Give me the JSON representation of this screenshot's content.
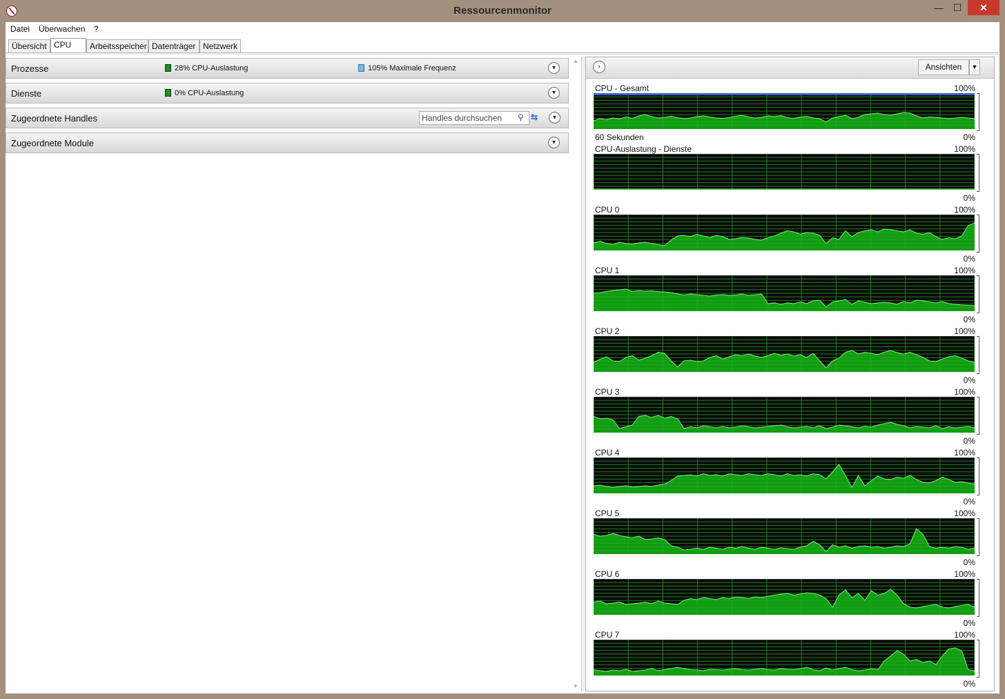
{
  "window": {
    "title": "Ressourcenmonitor"
  },
  "menu": {
    "file": "Datei",
    "monitor": "Überwachen",
    "help": "?"
  },
  "tabs": [
    "Übersicht",
    "CPU",
    "Arbeitsspeicher",
    "Datenträger",
    "Netzwerk"
  ],
  "active_tab": "CPU",
  "sections": {
    "processes": {
      "label": "Prozesse",
      "cpu_usage": "28% CPU-Auslastung",
      "max_freq": "105% Maximale Frequenz"
    },
    "services": {
      "label": "Dienste",
      "cpu_usage": "0% CPU-Auslastung"
    },
    "handles": {
      "label": "Zugeordnete Handles",
      "search_placeholder": "Handles durchsuchen"
    },
    "modules": {
      "label": "Zugeordnete Module"
    }
  },
  "right_pane": {
    "views_button": "Ansichten"
  },
  "colors": {
    "graph_bg": "#0b0b0b",
    "grid": "#1e7a1e",
    "fill": "#15b515",
    "line": "#7cf07c",
    "freq_line": "#3a62c8"
  },
  "graphs": [
    {
      "title": "CPU - Gesamt",
      "max": "100%",
      "min": "0%",
      "caption": "60 Sekunden",
      "values": [
        22,
        28,
        25,
        30,
        27,
        33,
        29,
        36,
        40,
        34,
        30,
        32,
        35,
        31,
        28,
        30,
        34,
        36,
        33,
        30,
        29,
        31,
        35,
        38,
        33,
        30,
        32,
        36,
        34,
        37,
        31,
        29,
        33,
        35,
        30,
        28,
        18,
        30,
        34,
        38,
        28,
        32,
        40,
        42,
        44,
        40,
        38,
        42,
        46,
        44,
        36,
        30,
        33,
        32,
        30,
        28,
        30,
        32,
        30,
        28
      ]
    },
    {
      "title": "CPU-Auslastung - Dienste",
      "max": "100%",
      "min": "0%",
      "caption": "",
      "values": [
        0,
        0,
        0,
        0,
        0,
        0,
        0,
        0,
        0,
        0,
        0,
        0,
        0,
        0,
        0,
        0,
        0,
        0,
        0,
        0,
        0,
        0,
        0,
        0,
        0,
        0,
        0,
        0,
        0,
        0,
        0,
        0,
        0,
        0,
        0,
        0,
        0,
        0,
        0,
        0,
        0,
        0,
        0,
        0,
        0,
        0,
        0,
        0,
        0,
        0,
        0,
        0,
        0,
        0,
        0,
        0,
        0,
        0,
        0,
        0
      ]
    },
    {
      "title": "CPU 0",
      "max": "100%",
      "min": "0%",
      "caption": "",
      "values": [
        20,
        25,
        18,
        15,
        22,
        18,
        16,
        20,
        22,
        18,
        15,
        12,
        28,
        40,
        42,
        38,
        45,
        40,
        35,
        42,
        38,
        30,
        32,
        36,
        34,
        30,
        28,
        35,
        40,
        48,
        55,
        52,
        45,
        50,
        48,
        42,
        18,
        35,
        30,
        55,
        38,
        50,
        55,
        58,
        52,
        60,
        58,
        55,
        52,
        58,
        48,
        45,
        50,
        38,
        30,
        35,
        32,
        40,
        70,
        78
      ]
    },
    {
      "title": "CPU 1",
      "max": "100%",
      "min": "0%",
      "caption": "",
      "values": [
        50,
        52,
        55,
        58,
        60,
        62,
        55,
        58,
        56,
        57,
        55,
        54,
        52,
        48,
        45,
        48,
        46,
        44,
        42,
        45,
        46,
        44,
        45,
        48,
        44,
        46,
        48,
        20,
        22,
        18,
        22,
        20,
        25,
        20,
        28,
        30,
        10,
        25,
        28,
        32,
        18,
        28,
        24,
        20,
        22,
        24,
        22,
        18,
        26,
        22,
        30,
        28,
        25,
        22,
        26,
        20,
        18,
        16,
        15,
        14
      ]
    },
    {
      "title": "CPU 2",
      "max": "100%",
      "min": "0%",
      "caption": "",
      "values": [
        25,
        35,
        42,
        30,
        28,
        40,
        45,
        32,
        38,
        45,
        55,
        52,
        30,
        12,
        30,
        32,
        28,
        30,
        40,
        45,
        35,
        42,
        48,
        45,
        50,
        44,
        40,
        45,
        52,
        46,
        50,
        44,
        48,
        40,
        52,
        30,
        10,
        30,
        38,
        55,
        60,
        50,
        55,
        52,
        48,
        55,
        60,
        54,
        50,
        55,
        48,
        40,
        30,
        28,
        35,
        42,
        45,
        38,
        30,
        25
      ]
    },
    {
      "title": "CPU 3",
      "max": "100%",
      "min": "0%",
      "caption": "",
      "values": [
        45,
        38,
        40,
        35,
        10,
        15,
        20,
        45,
        48,
        42,
        48,
        40,
        45,
        38,
        10,
        15,
        12,
        18,
        15,
        12,
        16,
        12,
        14,
        18,
        15,
        12,
        14,
        16,
        18,
        20,
        15,
        12,
        14,
        16,
        12,
        18,
        10,
        14,
        20,
        18,
        15,
        12,
        16,
        14,
        20,
        24,
        28,
        22,
        18,
        12,
        16,
        14,
        12,
        18,
        10,
        15,
        12,
        14,
        16,
        12
      ]
    },
    {
      "title": "CPU 4",
      "max": "100%",
      "min": "0%",
      "caption": "",
      "values": [
        20,
        22,
        18,
        15,
        18,
        20,
        16,
        18,
        20,
        18,
        22,
        25,
        35,
        48,
        50,
        52,
        48,
        55,
        50,
        52,
        48,
        55,
        52,
        50,
        55,
        52,
        50,
        55,
        52,
        48,
        55,
        50,
        52,
        48,
        55,
        52,
        40,
        60,
        82,
        50,
        15,
        50,
        20,
        35,
        48,
        40,
        38,
        45,
        42,
        50,
        38,
        30,
        28,
        35,
        45,
        38,
        30,
        32,
        28,
        25
      ]
    },
    {
      "title": "CPU 5",
      "max": "100%",
      "min": "0%",
      "caption": "",
      "values": [
        55,
        50,
        52,
        58,
        52,
        48,
        45,
        50,
        40,
        42,
        45,
        40,
        22,
        18,
        10,
        12,
        15,
        12,
        18,
        15,
        12,
        18,
        15,
        20,
        15,
        12,
        18,
        15,
        12,
        16,
        14,
        12,
        18,
        22,
        35,
        25,
        5,
        25,
        18,
        22,
        15,
        20,
        22,
        18,
        20,
        15,
        18,
        22,
        20,
        28,
        72,
        55,
        20,
        15,
        18,
        15,
        20,
        18,
        12,
        15
      ]
    },
    {
      "title": "CPU 6",
      "max": "100%",
      "min": "0%",
      "caption": "",
      "values": [
        35,
        38,
        30,
        32,
        35,
        28,
        30,
        32,
        35,
        30,
        38,
        32,
        30,
        28,
        40,
        45,
        42,
        48,
        45,
        42,
        48,
        45,
        50,
        48,
        45,
        50,
        48,
        52,
        55,
        58,
        60,
        55,
        58,
        62,
        60,
        55,
        45,
        20,
        55,
        70,
        48,
        60,
        40,
        68,
        55,
        60,
        72,
        55,
        30,
        20,
        18,
        22,
        25,
        28,
        20,
        18,
        22,
        25,
        28,
        20
      ]
    },
    {
      "title": "CPU 7",
      "max": "100%",
      "min": "0%",
      "caption": "",
      "values": [
        15,
        12,
        10,
        14,
        12,
        16,
        10,
        12,
        14,
        18,
        12,
        15,
        18,
        22,
        18,
        15,
        14,
        12,
        16,
        15,
        14,
        16,
        18,
        15,
        14,
        16,
        18,
        15,
        14,
        18,
        16,
        15,
        18,
        22,
        15,
        12,
        20,
        14,
        18,
        22,
        15,
        12,
        14,
        18,
        15,
        40,
        55,
        70,
        60,
        40,
        45,
        35,
        40,
        30,
        55,
        75,
        78,
        70,
        15,
        12
      ]
    }
  ]
}
